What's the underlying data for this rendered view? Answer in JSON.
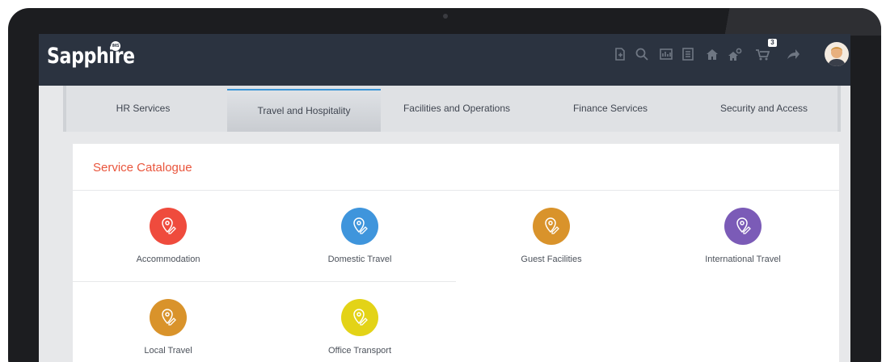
{
  "app": {
    "logo_text": "Sapphire",
    "logo_badge": "IMS",
    "notification_count": "3"
  },
  "toolbar": {
    "icons": [
      "document-icon",
      "search-icon",
      "dashboard-icon",
      "list-icon",
      "home-icon",
      "settings-home-icon",
      "cart-icon",
      "share-arrow-icon"
    ]
  },
  "tabs": [
    {
      "label": "HR Services",
      "active": false
    },
    {
      "label": "Travel and Hospitality",
      "active": true
    },
    {
      "label": "Facilities and Operations",
      "active": false
    },
    {
      "label": "Finance Services",
      "active": false
    },
    {
      "label": "Security and Access",
      "active": false
    }
  ],
  "catalogue": {
    "title": "Service Catalogue",
    "items": [
      {
        "label": "Accommodation",
        "color": "#ef4b3d"
      },
      {
        "label": "Domestic Travel",
        "color": "#3f95dc"
      },
      {
        "label": "Guest Facilities",
        "color": "#d9932b"
      },
      {
        "label": "International Travel",
        "color": "#7b5bb7"
      },
      {
        "label": "Local Travel",
        "color": "#d9932b"
      },
      {
        "label": "Office Transport",
        "color": "#e3d317"
      }
    ]
  },
  "colors": {
    "appbar": "#2b3340",
    "accent": "#3c95d6",
    "title": "#e9553c"
  }
}
